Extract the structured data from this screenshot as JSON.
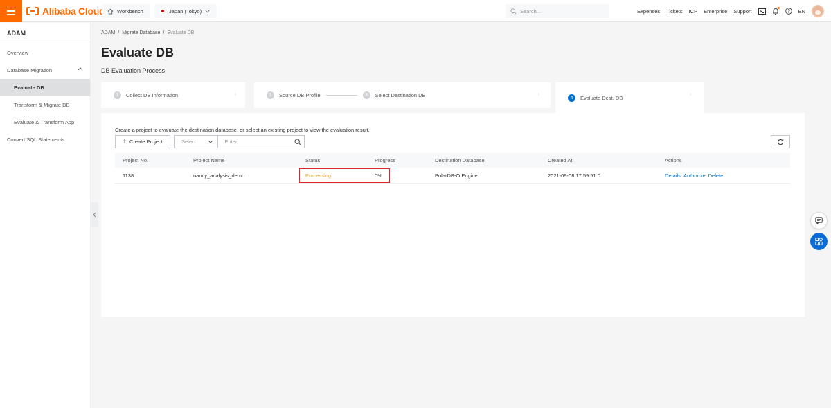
{
  "topbar": {
    "brand": "Alibaba Cloud",
    "workbench_label": "Workbench",
    "region_label": "Japan (Tokyo)",
    "search_placeholder": "Search...",
    "nav": [
      "Expenses",
      "Tickets",
      "ICP",
      "Enterprise",
      "Support"
    ],
    "language": "EN"
  },
  "sidebar": {
    "title": "ADAM",
    "items": [
      {
        "label": "Overview"
      },
      {
        "label": "Database Migration"
      },
      {
        "label": "Evaluate DB"
      },
      {
        "label": "Transform & Migrate DB"
      },
      {
        "label": "Evaluate & Transform App"
      },
      {
        "label": "Convert SQL Statements"
      }
    ]
  },
  "breadcrumb": [
    "ADAM",
    "Migrate Database",
    "Evaluate DB"
  ],
  "page_title": "Evaluate DB",
  "subtitle": "DB Evaluation Process",
  "steps": [
    {
      "num": "1",
      "label": "Collect DB Information"
    },
    {
      "num": "2",
      "label": "Source DB Profile"
    },
    {
      "num": "3",
      "label": "Select Destination DB"
    },
    {
      "num": "4",
      "label": "Evaluate Dest. DB"
    }
  ],
  "panel": {
    "hint": "Create a project to evaluate the destination database, or select an existing project to view the evaluation result.",
    "create_button": "Create Project",
    "select_placeholder": "Select",
    "input_placeholder": "Enter"
  },
  "table": {
    "headers": [
      "Project No.",
      "Project Name",
      "Status",
      "Progress",
      "Destination Database",
      "Created At",
      "Actions"
    ],
    "rows": [
      {
        "project_no": "1138",
        "project_name": "nancy_analysis_demo",
        "status": "Processing",
        "progress": "0%",
        "destination": "PolarDB-O Engine",
        "created_at": "2021-09-08 17:59:51.0",
        "actions": [
          "Details",
          "Authorize",
          "Delete"
        ]
      }
    ]
  },
  "colors": {
    "brand": "#ff6a00",
    "link": "#0070cc",
    "status_processing": "#f5a623",
    "highlight": "#e0262c"
  }
}
